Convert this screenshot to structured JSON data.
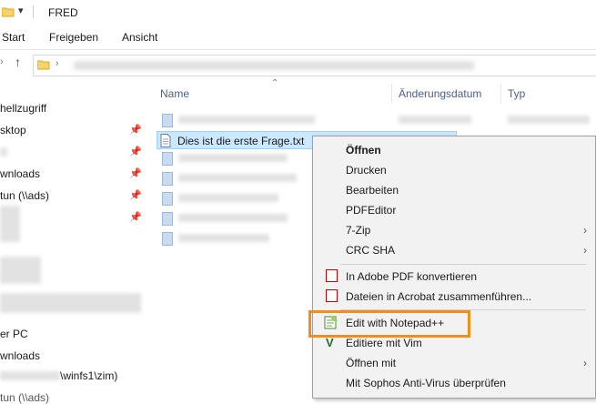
{
  "window": {
    "title": "FRED"
  },
  "ribbon": {
    "tabs": [
      "Start",
      "Freigeben",
      "Ansicht"
    ]
  },
  "nav": {
    "items": [
      "hellzugriff",
      "sktop",
      "wnloads",
      "tun (\\\\ads)",
      "er PC",
      "wnloads",
      "\\winfs1\\zim)",
      "tun (\\\\ads)"
    ]
  },
  "columns": {
    "name": "Name",
    "date": "Änderungsdatum",
    "type": "Typ"
  },
  "selected_file": {
    "name": "Dies ist die erste Frage.txt"
  },
  "menu": {
    "open": "Öffnen",
    "print": "Drucken",
    "edit": "Bearbeiten",
    "pdfeditor": "PDFEditor",
    "zip": "7-Zip",
    "crc": "CRC SHA",
    "adobe": "In Adobe PDF konvertieren",
    "acrobat": "Dateien in Acrobat zusammenführen...",
    "notepad": "Edit with Notepad++",
    "vim": "Editiere mit Vim",
    "openwith": "Öffnen mit",
    "sophos": "Mit Sophos Anti-Virus überprüfen"
  },
  "colors": {
    "accent_highlight": "#f28c1a",
    "selection": "#cce8ff"
  }
}
